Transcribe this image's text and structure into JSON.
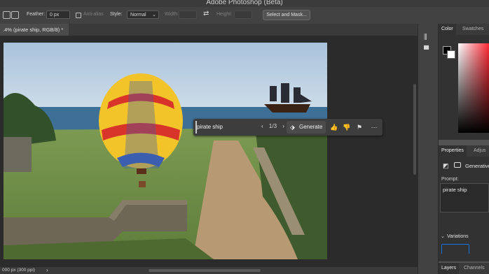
{
  "app": {
    "title": "Adobe Photoshop (Beta)"
  },
  "options_bar": {
    "feather_label": "Feather:",
    "feather_value": "0 px",
    "antialias_label": "Anti-alias",
    "style_label": "Style:",
    "style_value": "Normal",
    "width_label": "Width:",
    "height_label": "Height:",
    "select_mask_label": "Select and Mask..."
  },
  "document": {
    "tab_title": ".4% (pirate ship, RGB/8) *",
    "status": "000 px (300 ppi)"
  },
  "generative_bar": {
    "prompt": "pirate ship",
    "variation_counter": "1/3",
    "generate_label": "Generate",
    "prev_icon": "chevron-left-icon",
    "next_icon": "chevron-right-icon",
    "more_icon": "more-icon"
  },
  "panels": {
    "color_tab": "Color",
    "swatches_tab": "Swatches",
    "properties_tab": "Properties",
    "adjustments_tab": "Adjus",
    "layer_type": "Generative",
    "prompt_label": "Prompt:",
    "prompt_value": "pirate ship",
    "variations_label": "Variations",
    "layers_tab": "Layers",
    "channels_tab": "Channels"
  },
  "colors": {
    "accent": "#1473e6",
    "foreground": "#000000",
    "background": "#ffffff"
  }
}
